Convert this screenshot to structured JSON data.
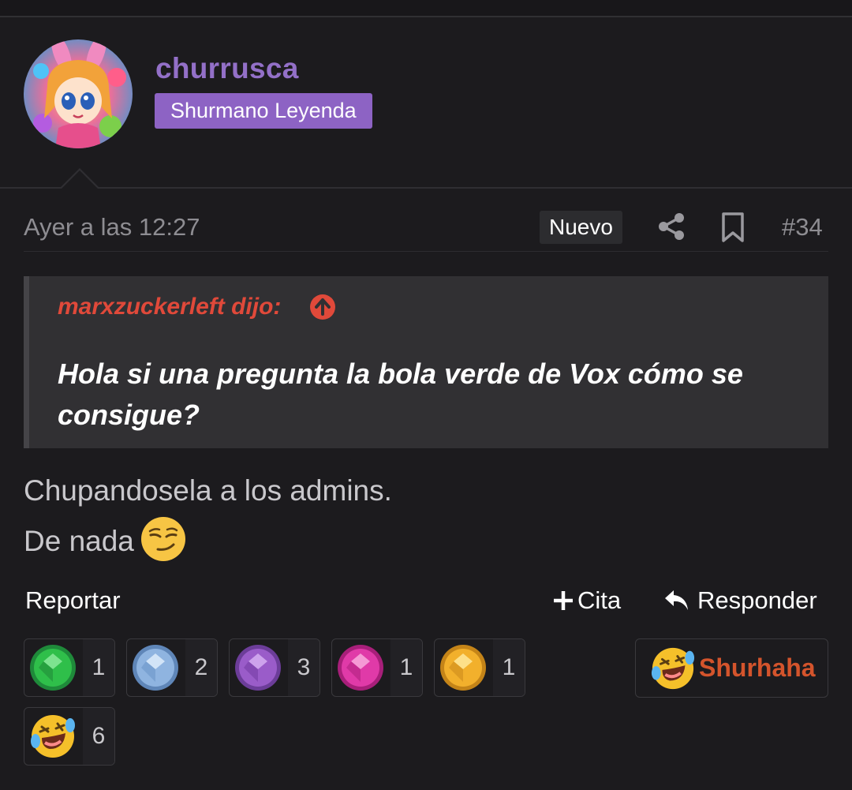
{
  "user": {
    "name": "churrusca",
    "rank": "Shurmano Leyenda"
  },
  "post": {
    "date": "Ayer a las 12:27",
    "new_label": "Nuevo",
    "number": "#34",
    "quote": {
      "author_label": "marxzuckerleft dijo:",
      "text": "Hola si una pregunta la bola verde de Vox cómo se consigue?"
    },
    "body_line1": "Chupandosela a los admins.",
    "body_line2": "De nada"
  },
  "actions": {
    "report": "Reportar",
    "quote": "Cita",
    "reply": "Responder"
  },
  "reactions": [
    {
      "icon": "green-gem-icon",
      "color": "#2fbf4a",
      "count": "1"
    },
    {
      "icon": "blue-gem-icon",
      "color": "#8fb4e0",
      "count": "2"
    },
    {
      "icon": "purple-gem-icon",
      "color": "#9a5cc9",
      "count": "3"
    },
    {
      "icon": "pink-gem-icon",
      "color": "#e03aa8",
      "count": "1"
    },
    {
      "icon": "gold-gem-icon",
      "color": "#f2b02c",
      "count": "1"
    },
    {
      "icon": "laughing-face-icon",
      "color": "#f5c02a",
      "count": "6"
    }
  ],
  "react_button": {
    "icon": "laughing-face-icon",
    "label": "Shurhaha"
  },
  "colors": {
    "background": "#1c1b1e",
    "username": "#9370c8",
    "rank_badge": "#8d63c4",
    "quote_author": "#e0493a",
    "shurhaha": "#d4542c"
  }
}
